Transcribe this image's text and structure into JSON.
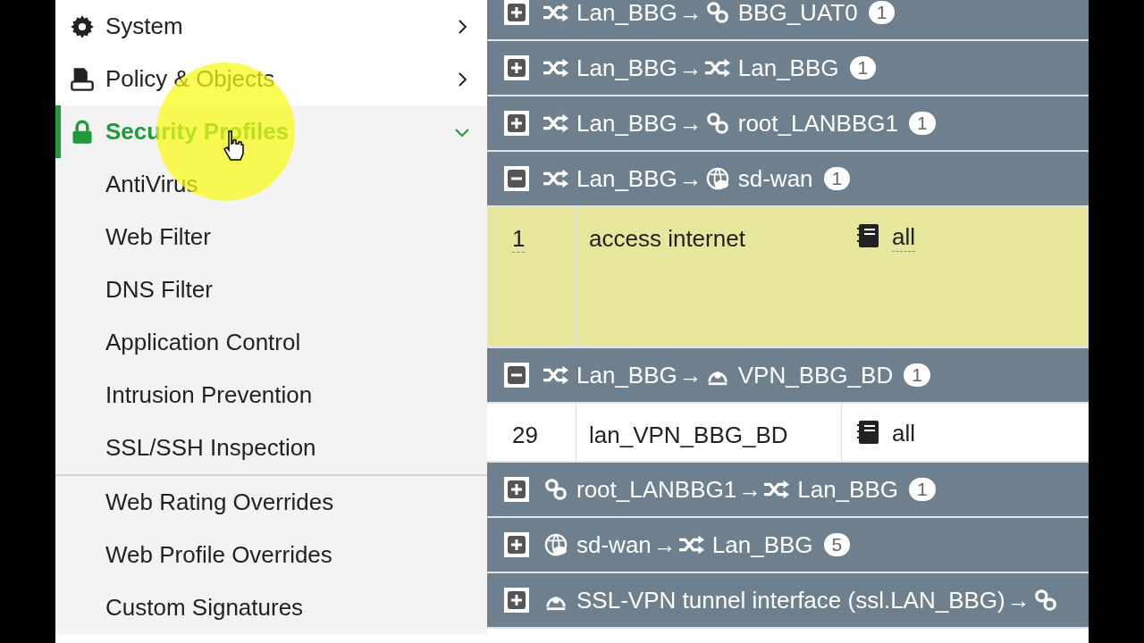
{
  "sidebar": {
    "items": [
      {
        "label": "System",
        "expanded": false,
        "selected": false
      },
      {
        "label": "Policy & Objects",
        "expanded": false,
        "selected": false
      },
      {
        "label": "Security Profiles",
        "expanded": true,
        "selected": true,
        "children": [
          {
            "label": "AntiVirus"
          },
          {
            "label": "Web Filter"
          },
          {
            "label": "DNS Filter"
          },
          {
            "label": "Application Control"
          },
          {
            "label": "Intrusion Prevention"
          },
          {
            "label": "SSL/SSH Inspection"
          },
          {
            "label": "Web Rating Overrides",
            "divider_above": true
          },
          {
            "label": "Web Profile Overrides"
          },
          {
            "label": "Custom Signatures"
          }
        ]
      }
    ]
  },
  "policy_groups": [
    {
      "expanded": false,
      "from": {
        "kind": "zone",
        "name": "Lan_BBG"
      },
      "arrow": "→",
      "to": {
        "kind": "link",
        "name": "BBG_UAT0"
      },
      "count": "1"
    },
    {
      "expanded": false,
      "from": {
        "kind": "zone",
        "name": "Lan_BBG"
      },
      "arrow": "→",
      "to": {
        "kind": "zone",
        "name": "Lan_BBG"
      },
      "count": "1"
    },
    {
      "expanded": false,
      "from": {
        "kind": "zone",
        "name": "Lan_BBG"
      },
      "arrow": "→",
      "to": {
        "kind": "link",
        "name": "root_LANBBG1"
      },
      "count": "1"
    },
    {
      "expanded": true,
      "from": {
        "kind": "zone",
        "name": "Lan_BBG"
      },
      "arrow": "→",
      "to": {
        "kind": "sdwan",
        "name": "sd-wan"
      },
      "count": "1",
      "rows": [
        {
          "id": "1",
          "name": "access internet",
          "source": "all",
          "selected": true
        }
      ]
    },
    {
      "expanded": true,
      "from": {
        "kind": "zone",
        "name": "Lan_BBG"
      },
      "arrow": "→",
      "to": {
        "kind": "tunnel",
        "name": "VPN_BBG_BD"
      },
      "count": "1",
      "rows": [
        {
          "id": "29",
          "name": "lan_VPN_BBG_BD",
          "source": "all",
          "selected": false
        }
      ]
    },
    {
      "expanded": false,
      "from": {
        "kind": "link",
        "name": "root_LANBBG1"
      },
      "arrow": "→",
      "to": {
        "kind": "zone",
        "name": "Lan_BBG"
      },
      "count": "1"
    },
    {
      "expanded": false,
      "from": {
        "kind": "sdwan",
        "name": "sd-wan"
      },
      "arrow": "→",
      "to": {
        "kind": "zone",
        "name": "Lan_BBG"
      },
      "count": "5"
    },
    {
      "expanded": false,
      "from": {
        "kind": "tunnel",
        "name": "SSL-VPN tunnel interface (ssl.LAN_BBG)"
      },
      "arrow": "→",
      "to": {
        "kind": "link"
      }
    }
  ]
}
